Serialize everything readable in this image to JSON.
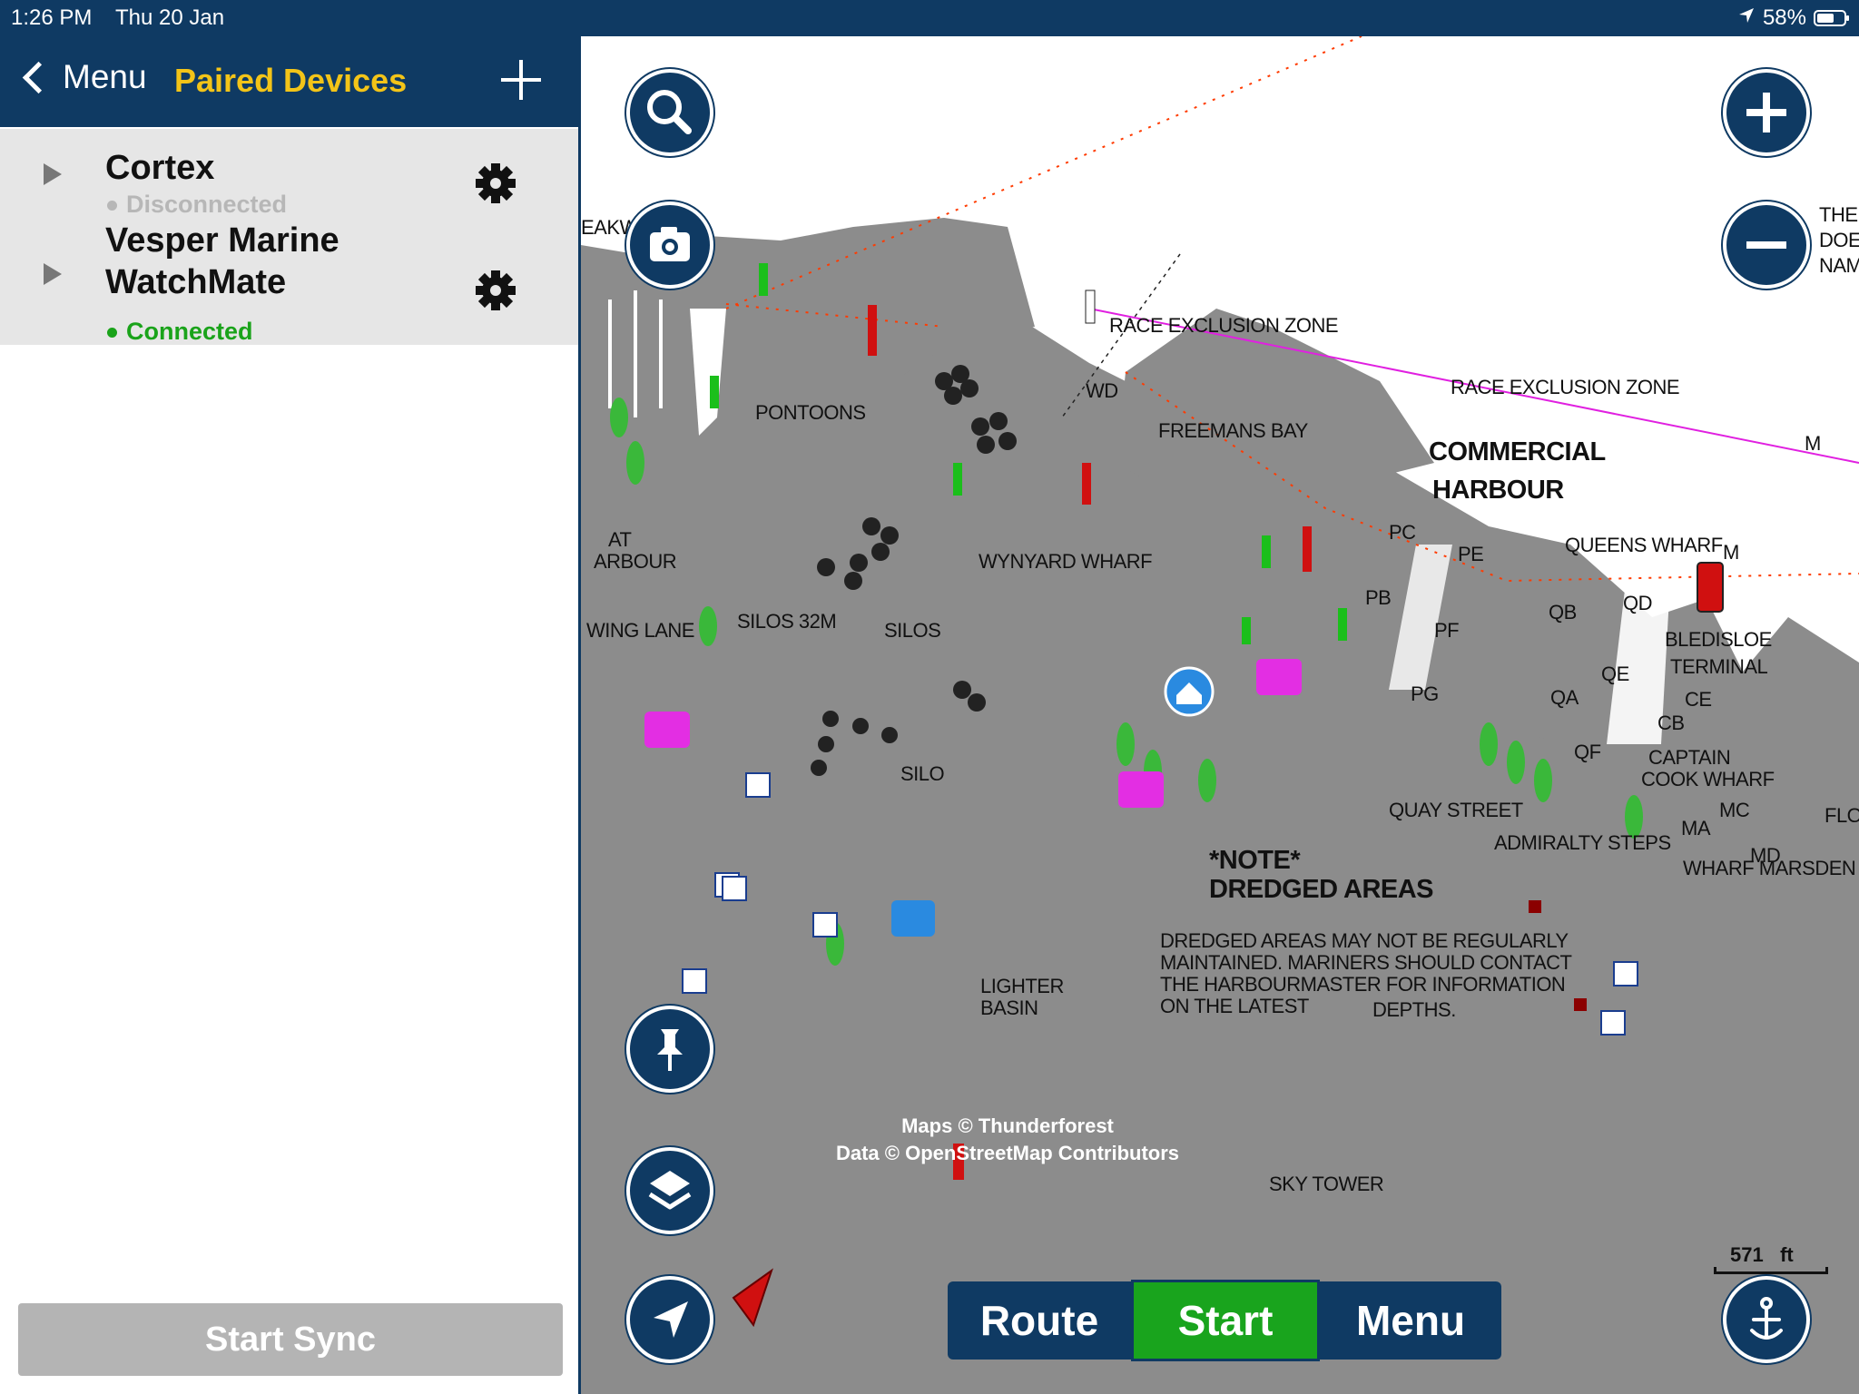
{
  "status_bar": {
    "time": "1:26 PM",
    "date": "Thu 20 Jan",
    "battery": "58%"
  },
  "panel": {
    "back_label": "Menu",
    "title": "Paired Devices",
    "devices": [
      {
        "name": "Cortex",
        "status": "Disconnected",
        "status_color": "#b7b7b7"
      },
      {
        "name": "Vesper Marine WatchMate",
        "status": "Connected",
        "status_color": "#1aa31a"
      }
    ],
    "sync_label": "Start Sync"
  },
  "map": {
    "labels": {
      "race_zone_1": "RACE EXCLUSION ZONE",
      "race_zone_2": "RACE EXCLUSION ZONE",
      "pontoons": "PONTOONS",
      "freemans_bay": "FREEMANS BAY",
      "commercial": "COMMERCIAL",
      "harbour": "HARBOUR",
      "wynyard": "WYNYARD WHARF",
      "silos32": "SILOS 32M",
      "silos": "SILOS",
      "silo": "SILO",
      "queens": "QUEENS WHARF",
      "bledisloe": "BLEDISLOE",
      "terminal": "TERMINAL",
      "captain": "CAPTAIN",
      "cook": "COOK WHARF",
      "quay": "QUAY STREET",
      "admiralty": "ADMIRALTY STEPS",
      "marsden": "WHARF MARSDEN",
      "note1": "*NOTE*",
      "note2": "DREDGED AREAS",
      "dredged_1": "DREDGED AREAS MAY  NOT BE REGULARLY",
      "dredged_2": "MAINTAINED. MARINERS       SHOULD CONTACT",
      "dredged_3": "THE HARBOURMASTER       FOR INFORMATION",
      "dredged_4": "ON THE LATEST",
      "dredged_5": "DEPTHS.",
      "lighter": "LIGHTER",
      "basin": "BASIN",
      "sky_tower": "SKY TOWER",
      "wd": "WD",
      "pc": "PC",
      "pe": "PE",
      "pb": "PB",
      "pf": "PF",
      "pg": "PG",
      "qa": "QA",
      "qb": "QB",
      "qd": "QD",
      "qe": "QE",
      "qf": "QF",
      "ce": "CE",
      "cb": "CB",
      "ma": "MA",
      "mc": "MC",
      "md": "MD",
      "m1": "M",
      "m2": "M",
      "eakw": "EAKW",
      "at": "AT",
      "arbour": "ARBOUR",
      "wing_lane": "WING LANE",
      "the": "THE",
      "doe": "DOE",
      "nam": "NAM",
      "flo": "FLO"
    },
    "attribution_1": "Maps © Thunderforest",
    "attribution_2": "Data © OpenStreetMap Contributors",
    "scale_value": "571",
    "scale_unit": "ft",
    "buttons": {
      "route": "Route",
      "start": "Start",
      "menu": "Menu"
    }
  }
}
